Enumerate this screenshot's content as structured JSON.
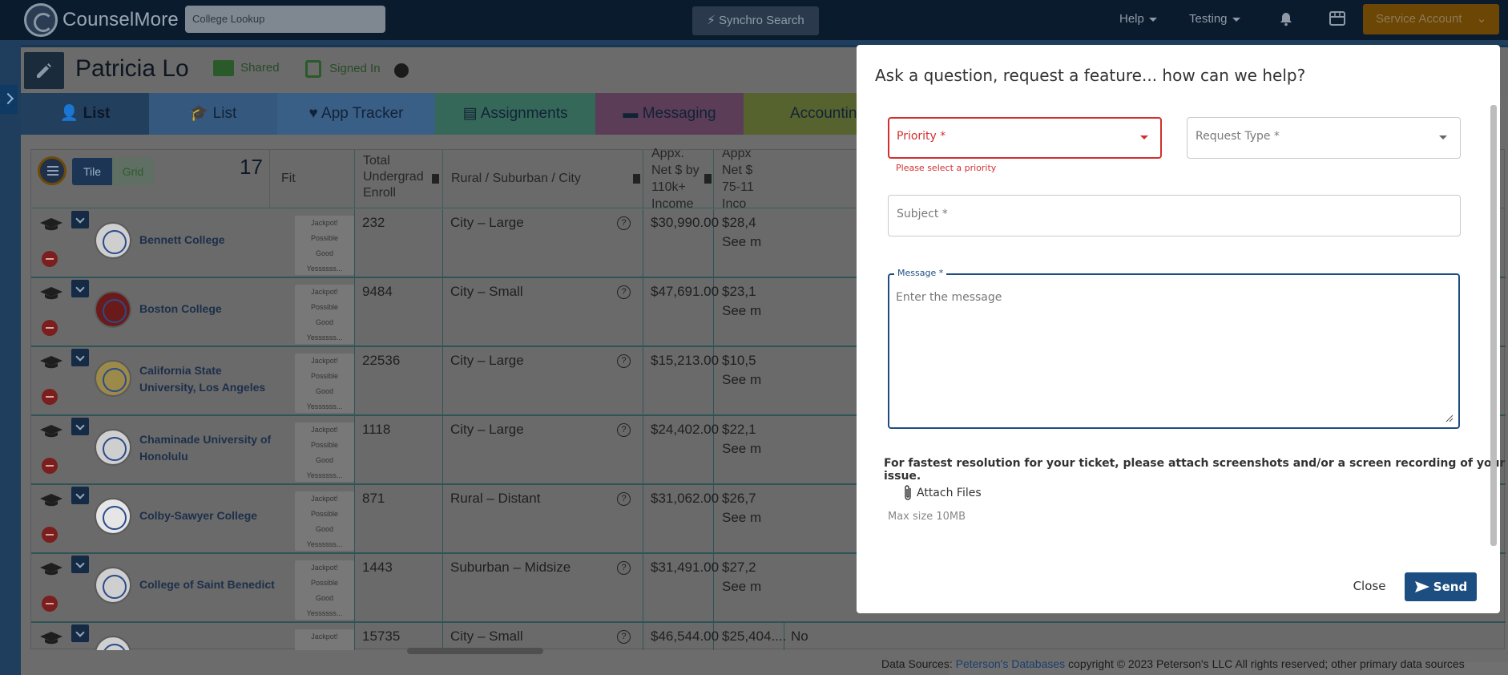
{
  "navbar": {
    "brand": "CounselMore",
    "college_lookup_placeholder": "College Lookup",
    "synchro_search": "Synchro Search",
    "help": "Help",
    "testing": "Testing",
    "service_account": "Service Account"
  },
  "student": {
    "name": "Patricia Lo",
    "shared": "Shared",
    "signed_in": "Signed In"
  },
  "tabs": [
    {
      "label": "List"
    },
    {
      "label": "List"
    },
    {
      "label": "App Tracker"
    },
    {
      "label": "Assignments"
    },
    {
      "label": "Messaging"
    },
    {
      "label": "Accountin"
    }
  ],
  "grid": {
    "toggle_tile": "Tile",
    "toggle_grid": "Grid",
    "count": "17",
    "columns": {
      "fit": "Fit",
      "enroll": "Total Undergrad Enroll",
      "rural": "Rural / Suburban / City",
      "net110": "Appx. Net $ by 110k+ Income",
      "net75": "Appx Net $ 75-11 Inco"
    },
    "fit_labels": [
      "Jackpot!",
      "Possible",
      "Good",
      "Yessssss..."
    ],
    "see_more": "See m",
    "rows": [
      {
        "name": "Bennett College",
        "enroll": "232",
        "locale": "City – Large",
        "net110": "$30,990.00",
        "net75": "$28,4"
      },
      {
        "name": "Boston College",
        "enroll": "9484",
        "locale": "City – Small",
        "net110": "$47,691.00",
        "net75": "$23,1"
      },
      {
        "name": "California State University, Los Angeles",
        "enroll": "22536",
        "locale": "City – Large",
        "net110": "$15,213.00",
        "net75": "$10,5"
      },
      {
        "name": "Chaminade University of Honolulu",
        "enroll": "1118",
        "locale": "City – Large",
        "net110": "$24,402.00",
        "net75": "$22,1"
      },
      {
        "name": "Colby-Sawyer College",
        "enroll": "871",
        "locale": "Rural – Distant",
        "net110": "$31,062.00",
        "net75": "$26,7"
      },
      {
        "name": "College of Saint Benedict",
        "enroll": "1443",
        "locale": "Suburban – Midsize",
        "net110": "$31,491.00",
        "net75": "$27,2"
      },
      {
        "name": "",
        "enroll": "15735",
        "locale": "City – Small",
        "net110": "$46,544.00",
        "net75": "$25,404....",
        "extra": "No"
      }
    ]
  },
  "footer": {
    "prefix": "Data Sources: ",
    "link": "Peterson's Databases",
    "suffix": " copyright © 2023 Peterson's LLC All rights reserved; other primary data sources"
  },
  "modal": {
    "title": "Ask a question, request a feature... how can we help?",
    "priority_label": "Priority *",
    "priority_error": "Please select a priority",
    "request_type_label": "Request Type *",
    "subject_label": "Subject *",
    "message_label": "Message *",
    "message_placeholder": "Enter the message",
    "attach_note": "For fastest resolution for your ticket, please attach screenshots and/or a screen recording of your issue.",
    "attach_files": "Attach Files",
    "max_size": "Max size 10MB",
    "close": "Close",
    "send": "Send"
  },
  "colors": {
    "accent": "#1d4e82",
    "error": "#d32f2f",
    "service_button": "#6b4604"
  },
  "icons": [
    "logo-icon",
    "bolt-icon",
    "bell-icon",
    "store-icon",
    "pencil-icon",
    "folder-user-icon",
    "lock-icon",
    "stopwatch-icon",
    "user-icon",
    "graduation-cap-icon",
    "heart-icon",
    "clipboard-icon",
    "message-icon",
    "dollar-icon",
    "menu-icon",
    "trash-icon",
    "question-icon",
    "paperclip-icon",
    "send-icon"
  ]
}
